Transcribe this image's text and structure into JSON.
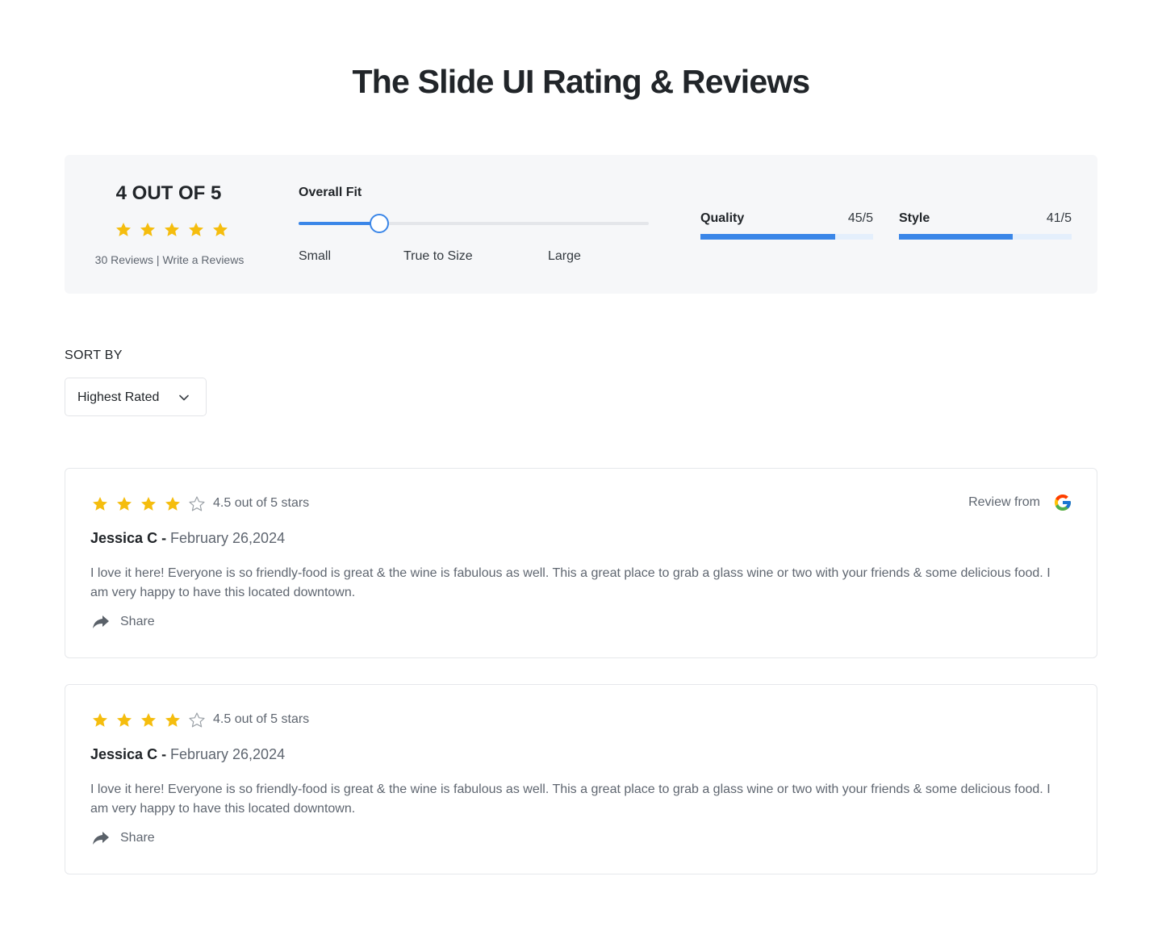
{
  "page": {
    "title": "The Slide UI Rating & Reviews"
  },
  "summary": {
    "score_title": "4 OUT OF 5",
    "stars_filled": 5,
    "reviews_count": "30 Reviews",
    "separator": "|",
    "write_review": "Write a Reviews",
    "fit": {
      "label": "Overall Fit",
      "value_fraction": 0.23,
      "options": [
        "Small",
        "True to Size",
        "Large"
      ]
    },
    "metrics": [
      {
        "label": "Quality",
        "value": "45/5",
        "fill_fraction": 0.78
      },
      {
        "label": "Style",
        "value": "41/5",
        "fill_fraction": 0.66
      }
    ]
  },
  "sort": {
    "label": "SORT BY",
    "selected": "Highest Rated"
  },
  "colors": {
    "accent": "#3a86e8",
    "star": "#f5bd0e",
    "star_empty": "#9aa0a6"
  },
  "reviews": [
    {
      "stars_filled": 4,
      "rating_text": "4.5 out of 5 stars",
      "author": "Jessica C -",
      "date": "February 26,2024",
      "text": "I love it here! Everyone is so friendly-food is great & the wine is fabulous as well. This a great place to grab a glass wine or two with your friends & some delicious food. I am very happy to have this located downtown.",
      "share_label": "Share",
      "source_label": "Review from",
      "source_icon": "google-icon"
    },
    {
      "stars_filled": 4,
      "rating_text": "4.5 out of 5 stars",
      "author": "Jessica C -",
      "date": "February 26,2024",
      "text": "I love it here! Everyone is so friendly-food is great & the wine is fabulous as well. This a great place to grab a glass wine or two with your friends & some delicious food. I am very happy to have this located downtown.",
      "share_label": "Share",
      "source_label": "",
      "source_icon": ""
    }
  ]
}
